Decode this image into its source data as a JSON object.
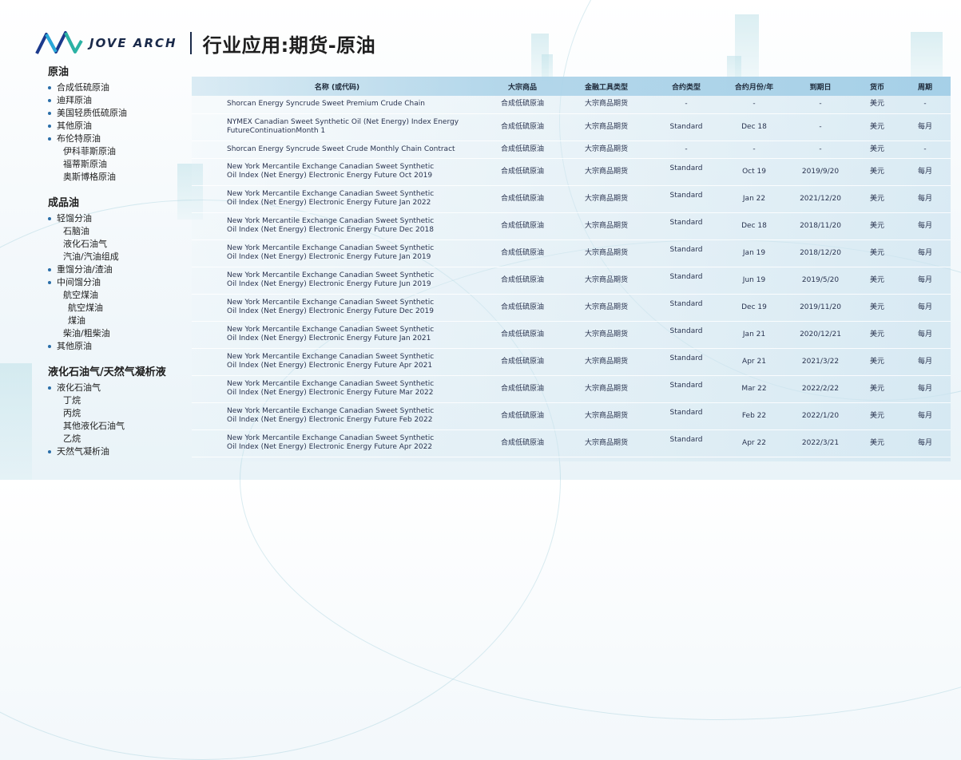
{
  "header": {
    "logo_text": "JOVE ARCH",
    "title": "行业应用:期货-原油"
  },
  "sidebar": [
    {
      "heading": "原油",
      "items": [
        {
          "level": 1,
          "label": "合成低硫原油"
        },
        {
          "level": 1,
          "label": "迪拜原油"
        },
        {
          "level": 1,
          "label": "美国轻质低硫原油"
        },
        {
          "level": 1,
          "label": "其他原油"
        },
        {
          "level": 1,
          "label": "布伦特原油"
        },
        {
          "level": 2,
          "label": "伊科菲斯原油"
        },
        {
          "level": 2,
          "label": "福蒂斯原油"
        },
        {
          "level": 2,
          "label": "奥斯博格原油"
        }
      ]
    },
    {
      "heading": "成品油",
      "items": [
        {
          "level": 1,
          "label": "轻馏分油"
        },
        {
          "level": 2,
          "label": "石脑油"
        },
        {
          "level": 2,
          "label": "液化石油气"
        },
        {
          "level": 2,
          "label": "汽油/汽油组成"
        },
        {
          "level": 1,
          "label": "重馏分油/渣油"
        },
        {
          "level": 1,
          "label": "中间馏分油"
        },
        {
          "level": 2,
          "label": "航空煤油"
        },
        {
          "level": 3,
          "label": "航空煤油"
        },
        {
          "level": 3,
          "label": "煤油"
        },
        {
          "level": 2,
          "label": "柴油/粗柴油"
        },
        {
          "level": 1,
          "label": "其他原油"
        }
      ]
    },
    {
      "heading": "液化石油气/天然气凝析液",
      "items": [
        {
          "level": 1,
          "label": "液化石油气"
        },
        {
          "level": 2,
          "label": "丁烷"
        },
        {
          "level": 2,
          "label": "丙烷"
        },
        {
          "level": 2,
          "label": "其他液化石油气"
        },
        {
          "level": 2,
          "label": "乙烷"
        },
        {
          "level": 1,
          "label": "天然气凝析油"
        }
      ]
    }
  ],
  "table": {
    "columns": [
      "名称 (或代码)",
      "大宗商品",
      "金融工具类型",
      "合约类型",
      "合约月份/年",
      "到期日",
      "货币",
      "周期"
    ],
    "rows": [
      {
        "name": [
          "Shorcan Energy Syncrude Sweet  Premium Crude Chain"
        ],
        "commodity": "合成低硫原油",
        "tool": "大宗商品期货",
        "type": "-",
        "month": "-",
        "expiry": "-",
        "currency": "美元",
        "period": "-",
        "tall": false
      },
      {
        "name": [
          "NYMEX Canadian Sweet Synthetic Oil (Net Energy) Index Energy",
          "FutureContinuationMonth 1"
        ],
        "commodity": "合成低硫原油",
        "tool": "大宗商品期货",
        "type": "Standard",
        "month": "Dec 18",
        "expiry": "-",
        "currency": "美元",
        "period": "每月",
        "tall": true
      },
      {
        "name": [
          "Shorcan Energy Syncrude Sweet Crude Monthly Chain Contract"
        ],
        "commodity": "合成低硫原油",
        "tool": "大宗商品期货",
        "type": "-",
        "month": "-",
        "expiry": "-",
        "currency": "美元",
        "period": "-",
        "tall": false
      },
      {
        "name": [
          "New York Mercantile Exchange Canadian Sweet Synthetic",
          "Oil Index (Net Energy) Electronic Energy Future Oct 2019"
        ],
        "commodity": "合成低硫原油",
        "tool": "大宗商品期货",
        "type": "Standard",
        "month": "Oct 19",
        "expiry": "2019/9/20",
        "currency": "美元",
        "period": "每月",
        "tall": true
      },
      {
        "name": [
          "New York Mercantile Exchange Canadian Sweet Synthetic",
          "Oil Index (Net Energy) Electronic Energy Future Jan 2022"
        ],
        "commodity": "合成低硫原油",
        "tool": "大宗商品期货",
        "type": "Standard",
        "month": "Jan 22",
        "expiry": "2021/12/20",
        "currency": "美元",
        "period": "每月",
        "tall": true
      },
      {
        "name": [
          "New York Mercantile Exchange Canadian Sweet Synthetic",
          "Oil Index (Net Energy) Electronic Energy Future Dec 2018"
        ],
        "commodity": "合成低硫原油",
        "tool": "大宗商品期货",
        "type": "Standard",
        "month": "Dec 18",
        "expiry": "2018/11/20",
        "currency": "美元",
        "period": "每月",
        "tall": true
      },
      {
        "name": [
          "New York Mercantile Exchange Canadian Sweet Synthetic",
          "Oil Index (Net Energy) Electronic Energy Future Jan 2019"
        ],
        "commodity": "合成低硫原油",
        "tool": "大宗商品期货",
        "type": "Standard",
        "month": "Jan 19",
        "expiry": "2018/12/20",
        "currency": "美元",
        "period": "每月",
        "tall": true
      },
      {
        "name": [
          "New York Mercantile Exchange Canadian Sweet Synthetic",
          "Oil Index (Net Energy) Electronic Energy Future Jun 2019"
        ],
        "commodity": "合成低硫原油",
        "tool": "大宗商品期货",
        "type": "Standard",
        "month": "Jun 19",
        "expiry": "2019/5/20",
        "currency": "美元",
        "period": "每月",
        "tall": true
      },
      {
        "name": [
          "New York Mercantile Exchange Canadian Sweet Synthetic",
          "Oil Index (Net Energy) Electronic Energy Future Dec 2019"
        ],
        "commodity": "合成低硫原油",
        "tool": "大宗商品期货",
        "type": "Standard",
        "month": "Dec 19",
        "expiry": "2019/11/20",
        "currency": "美元",
        "period": "每月",
        "tall": true
      },
      {
        "name": [
          "New York Mercantile Exchange Canadian Sweet Synthetic",
          "Oil Index (Net Energy) Electronic Energy Future Jan 2021"
        ],
        "commodity": "合成低硫原油",
        "tool": "大宗商品期货",
        "type": "Standard",
        "month": "Jan 21",
        "expiry": "2020/12/21",
        "currency": "美元",
        "period": "每月",
        "tall": true
      },
      {
        "name": [
          "New York Mercantile Exchange Canadian Sweet Synthetic",
          "Oil Index (Net Energy) Electronic Energy Future Apr 2021"
        ],
        "commodity": "合成低硫原油",
        "tool": "大宗商品期货",
        "type": "Standard",
        "month": "Apr 21",
        "expiry": "2021/3/22",
        "currency": "美元",
        "period": "每月",
        "tall": true
      },
      {
        "name": [
          "New York Mercantile Exchange Canadian Sweet Synthetic",
          "Oil Index (Net Energy) Electronic Energy Future Mar 2022"
        ],
        "commodity": "合成低硫原油",
        "tool": "大宗商品期货",
        "type": "Standard",
        "month": "Mar 22",
        "expiry": "2022/2/22",
        "currency": "美元",
        "period": "每月",
        "tall": true
      },
      {
        "name": [
          "New York Mercantile Exchange Canadian Sweet Synthetic",
          "Oil Index (Net Energy) Electronic Energy Future Feb 2022"
        ],
        "commodity": "合成低硫原油",
        "tool": "大宗商品期货",
        "type": "Standard",
        "month": "Feb 22",
        "expiry": "2022/1/20",
        "currency": "美元",
        "period": "每月",
        "tall": true
      },
      {
        "name": [
          "New York Mercantile Exchange Canadian Sweet Synthetic",
          "Oil Index (Net Energy) Electronic Energy Future Apr 2022"
        ],
        "commodity": "合成低硫原油",
        "tool": "大宗商品期货",
        "type": "Standard",
        "month": "Apr 22",
        "expiry": "2022/3/21",
        "currency": "美元",
        "period": "每月",
        "tall": true
      }
    ]
  }
}
